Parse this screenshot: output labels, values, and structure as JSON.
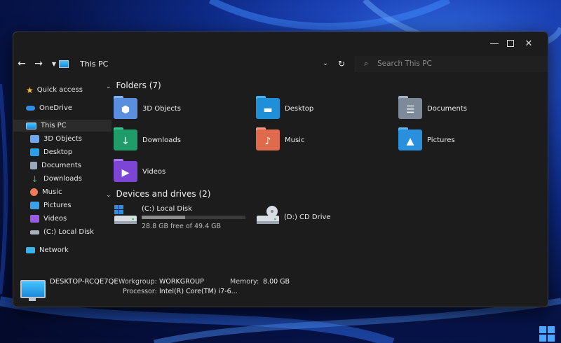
{
  "window": {
    "minimize_icon": "minimize-icon",
    "maximize_icon": "maximize-icon",
    "close_icon": "close-icon"
  },
  "nav": {
    "location": "This PC",
    "search_placeholder": "Search This PC"
  },
  "sidebar": {
    "items": [
      {
        "label": "Quick access",
        "icon": "star-icon",
        "color": "#f5c542"
      },
      {
        "label": "OneDrive",
        "icon": "cloud-icon",
        "color": "#2f8de4"
      },
      {
        "label": "This PC",
        "icon": "computer-icon",
        "color": "#39b2f0"
      },
      {
        "label": "3D Objects",
        "icon": "cube-icon",
        "color": "#6fa6f2"
      },
      {
        "label": "Desktop",
        "icon": "desktop-icon",
        "color": "#2a9fe8"
      },
      {
        "label": "Documents",
        "icon": "document-icon",
        "color": "#9aa8b8"
      },
      {
        "label": "Downloads",
        "icon": "download-icon",
        "color": "#27b57a"
      },
      {
        "label": "Music",
        "icon": "music-icon",
        "color": "#f07b5c"
      },
      {
        "label": "Pictures",
        "icon": "picture-icon",
        "color": "#3aa0ea"
      },
      {
        "label": "Videos",
        "icon": "video-icon",
        "color": "#9a5ce6"
      },
      {
        "label": "(C:) Local Disk",
        "icon": "drive-icon",
        "color": "#aab3bd"
      },
      {
        "label": "Network",
        "icon": "network-icon",
        "color": "#39b2f0"
      }
    ]
  },
  "folders_group": {
    "title": "Folders (7)"
  },
  "folders": [
    {
      "name": "3D Objects",
      "color": "#5a8fe0",
      "tab": "#7fb1f5",
      "glyph": "⬢"
    },
    {
      "name": "Desktop",
      "color": "#1f8fd8",
      "tab": "#46b1f2",
      "glyph": "▬"
    },
    {
      "name": "Documents",
      "color": "#7c8a9a",
      "tab": "#a7b4c2",
      "glyph": "☰"
    },
    {
      "name": "Downloads",
      "color": "#1f9c6a",
      "tab": "#35c489",
      "glyph": "↓"
    },
    {
      "name": "Music",
      "color": "#e06a4c",
      "tab": "#f4967b",
      "glyph": "♪"
    },
    {
      "name": "Pictures",
      "color": "#2a8fdc",
      "tab": "#5cb6f4",
      "glyph": "▲"
    },
    {
      "name": "Videos",
      "color": "#7d45d6",
      "tab": "#a577f0",
      "glyph": "▶"
    }
  ],
  "drives_group": {
    "title": "Devices and drives (2)"
  },
  "drives": [
    {
      "name": "(C:) Local Disk",
      "free": "28.8 GB free of 49.4 GB",
      "used_fraction": 0.417
    },
    {
      "name": "(D:) CD Drive"
    }
  ],
  "details": {
    "computer_name": "DESKTOP-RCQE7QE",
    "workgroup_label": "Workgroup:",
    "workgroup_value": "WORKGROUP",
    "memory_label": "Memory:",
    "memory_value": "8.00 GB",
    "processor_label": "Processor:",
    "processor_value": "Intel(R) Core(TM) i7-6..."
  }
}
